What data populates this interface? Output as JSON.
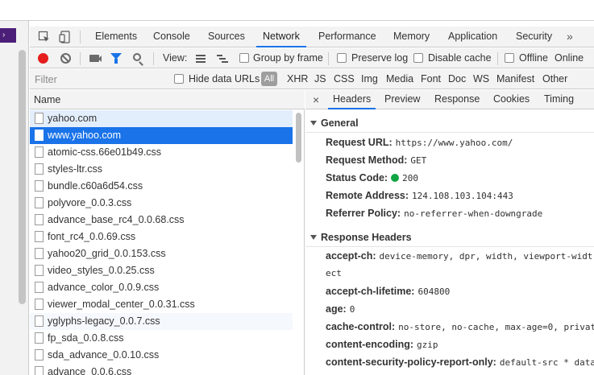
{
  "devtools_tabs": [
    "Elements",
    "Console",
    "Sources",
    "Network",
    "Performance",
    "Memory",
    "Application",
    "Security"
  ],
  "more_tabs": "»",
  "active_tab": "Network",
  "toolbar": {
    "view_label": "View:",
    "group_by_frame": "Group by frame",
    "preserve_log": "Preserve log",
    "disable_cache": "Disable cache",
    "offline": "Offline",
    "throttle": "Online"
  },
  "filter": {
    "placeholder": "Filter",
    "hide_data_urls": "Hide data URLs",
    "all": "All",
    "types": [
      "XHR",
      "JS",
      "CSS",
      "Img",
      "Media",
      "Font",
      "Doc",
      "WS",
      "Manifest",
      "Other"
    ]
  },
  "requests": {
    "header": "Name",
    "items": [
      "yahoo.com",
      "www.yahoo.com",
      "atomic-css.66e01b49.css",
      "styles-ltr.css",
      "bundle.c60a6d54.css",
      "polyvore_0.0.3.css",
      "advance_base_rc4_0.0.68.css",
      "font_rc4_0.0.69.css",
      "yahoo20_grid_0.0.153.css",
      "video_styles_0.0.25.css",
      "advance_color_0.0.9.css",
      "viewer_modal_center_0.0.31.css",
      "yglyphs-legacy_0.0.7.css",
      "fp_sda_0.0.8.css",
      "sda_advance_0.0.10.css",
      "advance_0.0.6.css"
    ]
  },
  "detail": {
    "close": "×",
    "tabs": [
      "Headers",
      "Preview",
      "Response",
      "Cookies",
      "Timing"
    ],
    "general": {
      "title": "General",
      "request_url_label": "Request URL:",
      "request_url": "https://www.yahoo.com/",
      "request_method_label": "Request Method:",
      "request_method": "GET",
      "status_code_label": "Status Code:",
      "status_code": "200",
      "status_color": "#0fa543",
      "remote_address_label": "Remote Address:",
      "remote_address": "124.108.103.104:443",
      "referrer_policy_label": "Referrer Policy:",
      "referrer_policy": "no-referrer-when-downgrade"
    },
    "response_headers": {
      "title": "Response Headers",
      "accept_ch_label": "accept-ch:",
      "accept_ch": "device-memory, dpr, width, viewport-widt",
      "accept_ch_wrap": "ect",
      "accept_ch_lifetime_label": "accept-ch-lifetime:",
      "accept_ch_lifetime": "604800",
      "age_label": "age:",
      "age": "0",
      "cache_control_label": "cache-control:",
      "cache_control": "no-store, no-cache, max-age=0, privat",
      "content_encoding_label": "content-encoding:",
      "content_encoding": "gzip",
      "csp_label": "content-security-policy-report-only:",
      "csp": "default-src * data"
    }
  },
  "colors": {
    "accent": "#1a73e8",
    "record": "#e51d1d"
  }
}
